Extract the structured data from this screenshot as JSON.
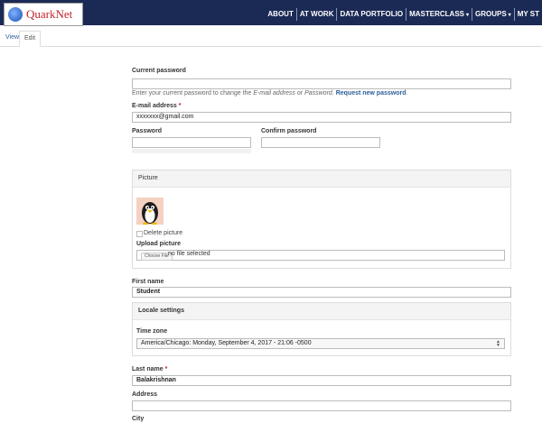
{
  "header": {
    "logo_text": "QuarkNet",
    "nav": [
      "ABOUT",
      "AT WORK",
      "DATA PORTFOLIO",
      "MASTERCLASS",
      "GROUPS",
      "MY ST"
    ],
    "nav_caret": "▾"
  },
  "tabs": {
    "view": "View",
    "edit": "Edit"
  },
  "form": {
    "current_password_label": "Current password",
    "current_password_desc_1": "Enter your current password to change the ",
    "current_password_desc_em1": "E-mail address",
    "current_password_desc_2": " or ",
    "current_password_desc_em2": "Password",
    "current_password_desc_3": ". ",
    "request_new_password": "Request new password",
    "email_label": "E-mail address",
    "required_mark": "*",
    "email_value": "xxxxxxx@gmail.com",
    "password_label": "Password",
    "confirm_password_label": "Confirm password",
    "picture_legend": "Picture",
    "delete_picture": "Delete picture",
    "upload_picture_label": "Upload picture",
    "choose_file": "Choose File",
    "no_file": "no file selected",
    "first_name_label": "First name",
    "first_name_value": "Student",
    "locale_legend": "Locale settings",
    "time_zone_label": "Time zone",
    "time_zone_value": "America/Chicago: Monday, September 4, 2017 - 21:06 -0500",
    "last_name_label": "Last name",
    "last_name_value": "Balakrishnan",
    "address_label": "Address",
    "city_label": "City"
  },
  "colors": {
    "topbar": "#1b2a55",
    "link": "#2c5e99",
    "required": "#c0232a"
  }
}
